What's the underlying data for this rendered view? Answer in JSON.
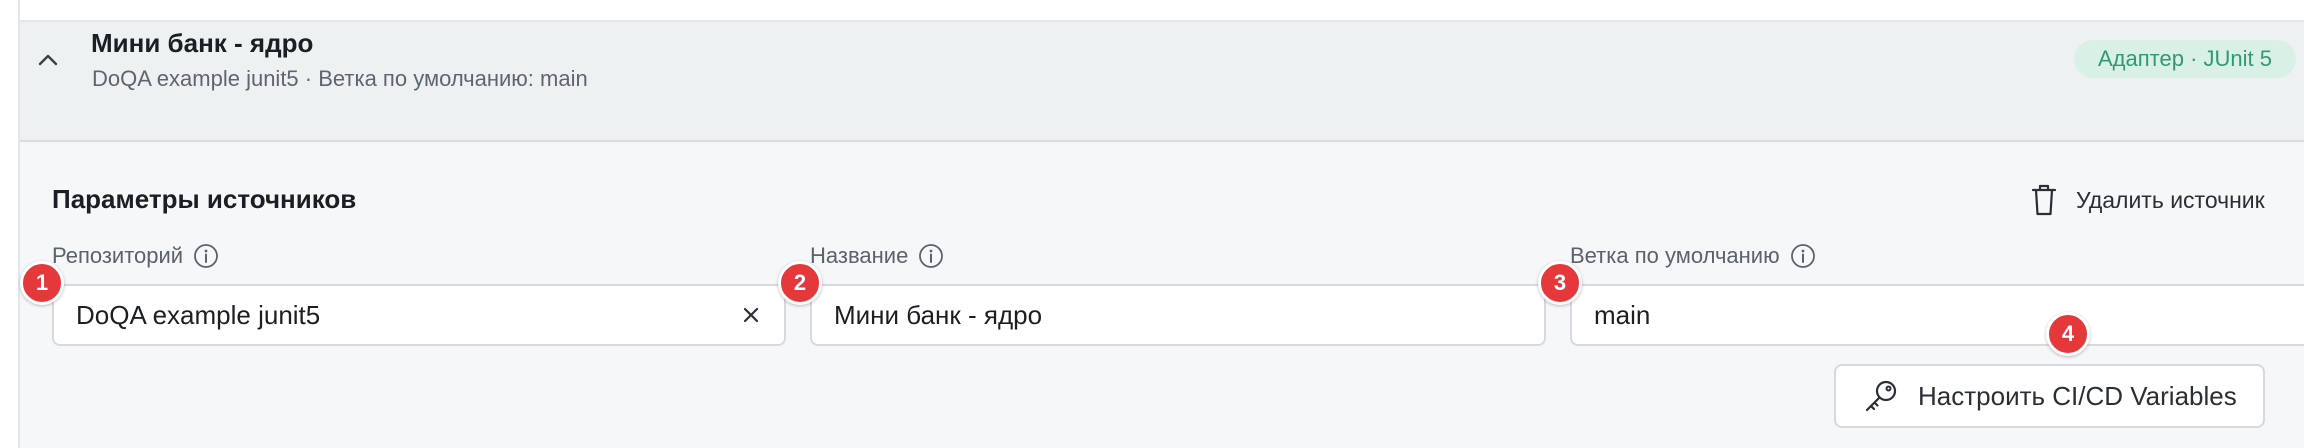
{
  "source": {
    "title": "Мини банк - ядро",
    "subtitle": "DoQA example junit5 · Ветка по умолчанию: main",
    "adapter_badge": "Адаптер · JUnit 5",
    "collapse_icon": "chevron-up-icon"
  },
  "params": {
    "section_title": "Параметры источников",
    "delete_label": "Удалить источник",
    "fields": [
      {
        "label": "Репозиторий",
        "value": "DoQA example junit5",
        "marker": "1"
      },
      {
        "label": "Название",
        "value": "Мини банк - ядро",
        "marker": "2"
      },
      {
        "label": "Ветка по умолчанию",
        "value": "main",
        "marker": "3"
      }
    ],
    "cicd_button": "Настроить CI/CD Variables",
    "cicd_marker": "4"
  },
  "colors": {
    "accent_green": "#2f9a73",
    "badge_bg": "#d9f0e7",
    "marker_red": "#e5383b"
  }
}
